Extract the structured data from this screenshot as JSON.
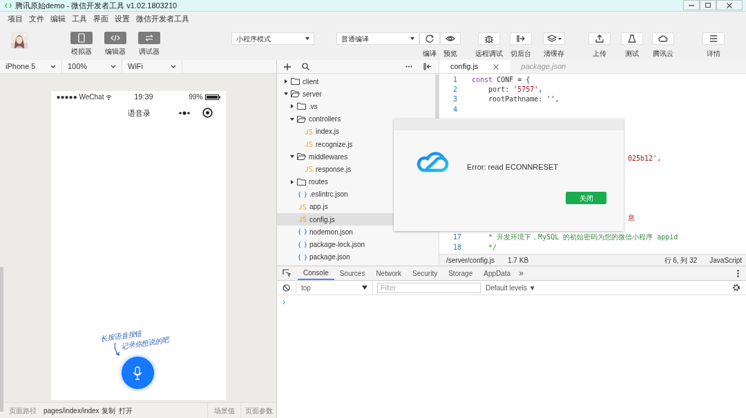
{
  "window": {
    "title": "腾讯原始demo - 微信开发者工具 v1.02.1803210"
  },
  "menu": [
    "项目",
    "文件",
    "编辑",
    "工具",
    "界面",
    "设置",
    "微信开发者工具"
  ],
  "view_toggles": [
    {
      "label": "模拟器",
      "on": true
    },
    {
      "label": "编辑器",
      "on": true
    },
    {
      "label": "调试器",
      "on": true
    }
  ],
  "mode_select": {
    "value": "小程序模式"
  },
  "compile_select": {
    "value": "普通编译"
  },
  "toolbar": [
    {
      "label": "编译"
    },
    {
      "label": "预览"
    },
    {
      "label": "远程调试"
    },
    {
      "label": "切后台"
    },
    {
      "label": "清缓存"
    },
    {
      "label": "上传"
    },
    {
      "label": "测试"
    },
    {
      "label": "腾讯云"
    },
    {
      "label": "详情"
    }
  ],
  "simulator": {
    "device": "iPhone 5",
    "zoom": "100%",
    "network": "WiFi",
    "status_bar": {
      "carrier": "●●●●● WeChat",
      "time": "19:39",
      "battery": "99%"
    },
    "nav_title": "语音录",
    "hint_lines": [
      "长按语音按钮",
      "记录你想说的吧"
    ]
  },
  "page_bar": {
    "label": "页面路径",
    "path": "pages/index/index",
    "copy": "复制",
    "open": "打开",
    "scene": "场景值",
    "params": "页面参数"
  },
  "file_tree": [
    {
      "name": "client",
      "kind": "folder",
      "expanded": false,
      "selected": false
    },
    {
      "name": "server",
      "kind": "folder",
      "expanded": true,
      "selected": false,
      "children": [
        {
          "name": ".vs",
          "kind": "folder",
          "expanded": false,
          "selected": false
        },
        {
          "name": "controllers",
          "kind": "folder",
          "expanded": true,
          "selected": false,
          "children": [
            {
              "name": "index.js",
              "kind": "js",
              "selected": false
            },
            {
              "name": "recognize.js",
              "kind": "js",
              "selected": false
            }
          ]
        },
        {
          "name": "middlewares",
          "kind": "folder",
          "expanded": true,
          "selected": false,
          "children": [
            {
              "name": "response.js",
              "kind": "js",
              "selected": false
            }
          ]
        },
        {
          "name": "routes",
          "kind": "folder",
          "expanded": false,
          "selected": false
        },
        {
          "name": ".eslintrc.json",
          "kind": "json",
          "selected": false
        },
        {
          "name": "app.js",
          "kind": "js",
          "selected": false
        },
        {
          "name": "config.js",
          "kind": "js",
          "selected": true
        },
        {
          "name": "nodemon.json",
          "kind": "json",
          "selected": false
        },
        {
          "name": "package-lock.json",
          "kind": "json",
          "selected": false
        },
        {
          "name": "package.json",
          "kind": "json",
          "selected": false
        }
      ]
    }
  ],
  "editor_tabs": [
    {
      "label": "config.js",
      "selected": true
    },
    {
      "label": "package.json",
      "selected": false
    }
  ],
  "code_lines": [
    {
      "number": "1",
      "kind": "code",
      "text": "const CONF = {"
    },
    {
      "number": "2",
      "kind": "code",
      "text": "    port: '5757',"
    },
    {
      "number": "3",
      "kind": "code",
      "text": "    rootPathname: '',"
    },
    {
      "number": "4",
      "kind": "code"
    },
    {
      "kind": "hidden"
    },
    {
      "kind": "hidden"
    },
    {
      "kind": "hidden"
    },
    {
      "kind": "hidden"
    },
    {
      "kind": "fragment",
      "text": "025b12',"
    },
    {
      "kind": "hidden"
    },
    {
      "kind": "hidden"
    },
    {
      "kind": "hidden"
    },
    {
      "kind": "hidden"
    },
    {
      "kind": "hidden"
    },
    {
      "kind": "fragment",
      "text": "息"
    },
    {
      "kind": "hidden"
    },
    {
      "number": "17",
      "kind": "comment",
      "text": "    * 开发环境下，MySQL 的初始密码为您的微信小程序 appid"
    },
    {
      "number": "18",
      "kind": "comment",
      "text": "    */"
    }
  ],
  "editor_status": {
    "path": "/server/config.js",
    "size": "1.7 KB",
    "position": "行 6, 列 32",
    "language": "JavaScript"
  },
  "dialog": {
    "message": "Error: read ECONNRESET",
    "button": "关闭"
  },
  "devtools": {
    "tabs": [
      {
        "label": "Console",
        "selected": true
      },
      {
        "label": "Sources",
        "selected": false
      },
      {
        "label": "Network",
        "selected": false
      },
      {
        "label": "Security",
        "selected": false
      },
      {
        "label": "Storage",
        "selected": false
      },
      {
        "label": "AppData",
        "selected": false
      }
    ],
    "more": "»",
    "context": "top",
    "filter_placeholder": "Filter",
    "levels": "Default levels ▼",
    "prompt": "›"
  }
}
